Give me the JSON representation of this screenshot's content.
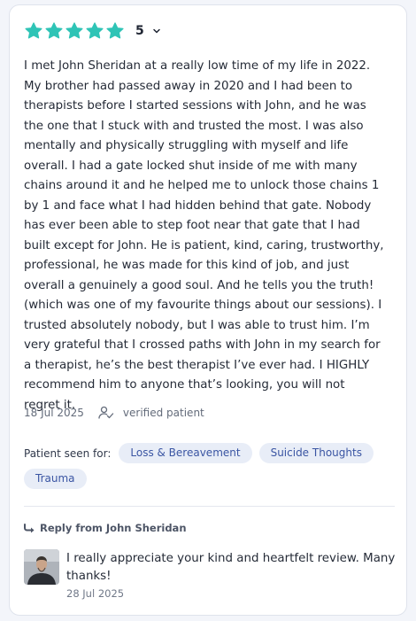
{
  "review": {
    "rating_value": "5",
    "star_count": 5,
    "star_color": "#2ec4b6",
    "text": "I met John Sheridan at a really low time of my life in 2022.\nMy brother had passed away in 2020 and I had been to\ntherapists before I started sessions with John, and he was\nthe one that I stuck with and trusted the most. I was also\nmentally and physically struggling with myself and life\noverall. I had a gate locked shut inside of me with many\nchains around it and he helped me to unlock those chains 1\nby 1 and face what I had hidden behind that gate. Nobody\nhas ever been able to step foot near that gate that I had\nbuilt except for John. He is patient, kind, caring, trustworthy,\nprofessional, he was made for this kind of job, and just\noverall a genuinely a good soul. And he tells you the truth!\n(which was one of my favourite things about our sessions). I\ntrusted absolutely nobody, but I was able to trust him. I’m\nvery grateful that I crossed paths with John in my search for\na therapist, he’s the best therapist I’ve ever had. I HIGHLY\nrecommend him to anyone that’s looking, you will not\nregret it.",
    "date": "18 Jul 2025",
    "verified_label": "verified patient",
    "seen_for_label": "Patient seen for:",
    "tags": [
      "Loss & Bereavement",
      "Suicide Thoughts",
      "Trauma"
    ]
  },
  "reply": {
    "heading": "Reply from John Sheridan",
    "text": "I really appreciate your kind and heartfelt review. Many thanks!",
    "date": "28 Jul 2025"
  },
  "icons": {
    "rating": "star-icon",
    "dropdown": "chevron-down-icon",
    "verified": "verified-user-icon",
    "reply": "reply-arrow-icon"
  },
  "colors": {
    "tag_bg": "#e8edf7",
    "tag_text": "#3a55a3"
  }
}
